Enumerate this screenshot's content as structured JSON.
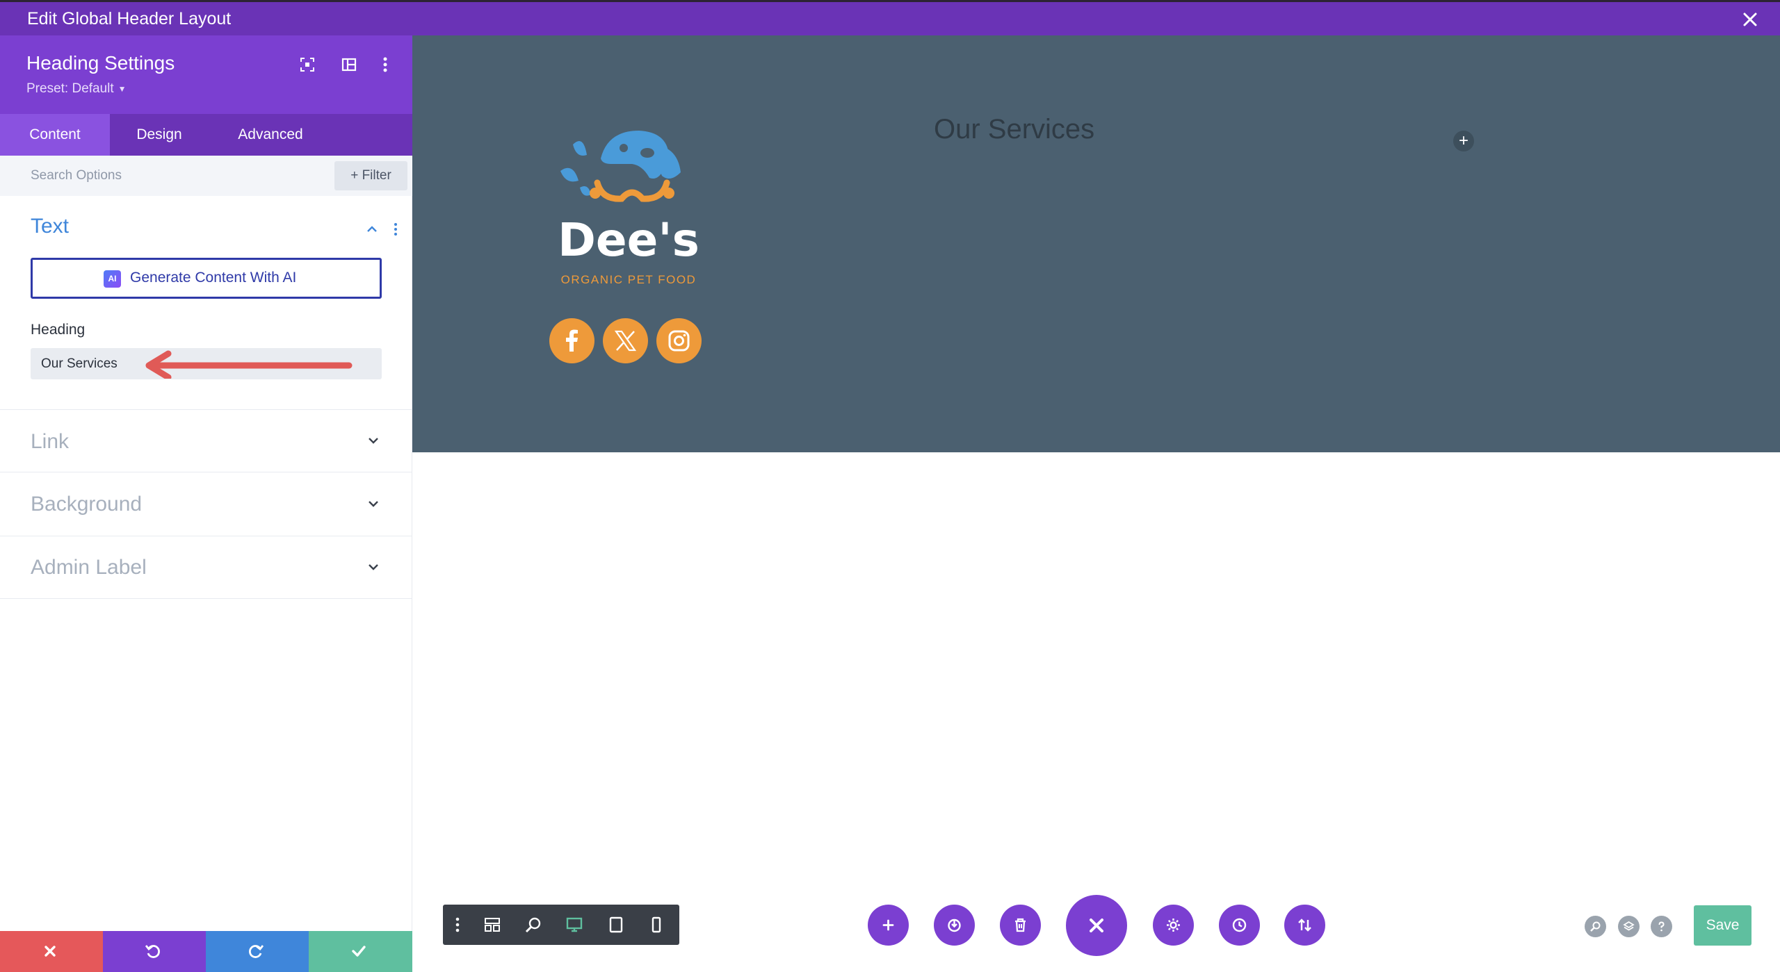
{
  "window": {
    "title": "Edit Global Header Layout"
  },
  "sidebar": {
    "header": {
      "title": "Heading Settings",
      "preset": "Preset: Default"
    },
    "tabs": [
      {
        "label": "Content",
        "active": true
      },
      {
        "label": "Design",
        "active": false
      },
      {
        "label": "Advanced",
        "active": false
      }
    ],
    "search": {
      "placeholder": "Search Options",
      "filter_label": "Filter"
    },
    "sections": {
      "text": {
        "title": "Text",
        "expanded": true,
        "ai_button": "Generate Content With AI",
        "ai_badge": "AI",
        "heading_label": "Heading",
        "heading_value": "Our Services"
      },
      "link": {
        "title": "Link",
        "expanded": false
      },
      "background": {
        "title": "Background",
        "expanded": false
      },
      "admin_label": {
        "title": "Admin Label",
        "expanded": false
      }
    },
    "footer_actions": [
      "discard",
      "undo",
      "redo",
      "save-changes"
    ]
  },
  "canvas": {
    "logo": {
      "name": "Dee's",
      "tagline": "ORGANIC PET FOOD"
    },
    "socials": [
      "facebook",
      "x",
      "instagram"
    ],
    "heading": "Our Services"
  },
  "toolbar": {
    "responsive_views": [
      "menu",
      "wireframe",
      "zoom",
      "desktop",
      "tablet",
      "phone"
    ],
    "actions": [
      "add",
      "portability",
      "clear",
      "close",
      "page-settings",
      "history",
      "layers-sort"
    ],
    "save_label": "Save"
  },
  "colors": {
    "purple_dark": "#6a33b6",
    "purple": "#7b3fd1",
    "header_bg": "#4b6070",
    "accent_orange": "#ee9a3a",
    "logo_blue": "#4a9bd9",
    "save_green": "#5fbf9f",
    "discard_red": "#e5585a",
    "redo_blue": "#3f86da"
  }
}
